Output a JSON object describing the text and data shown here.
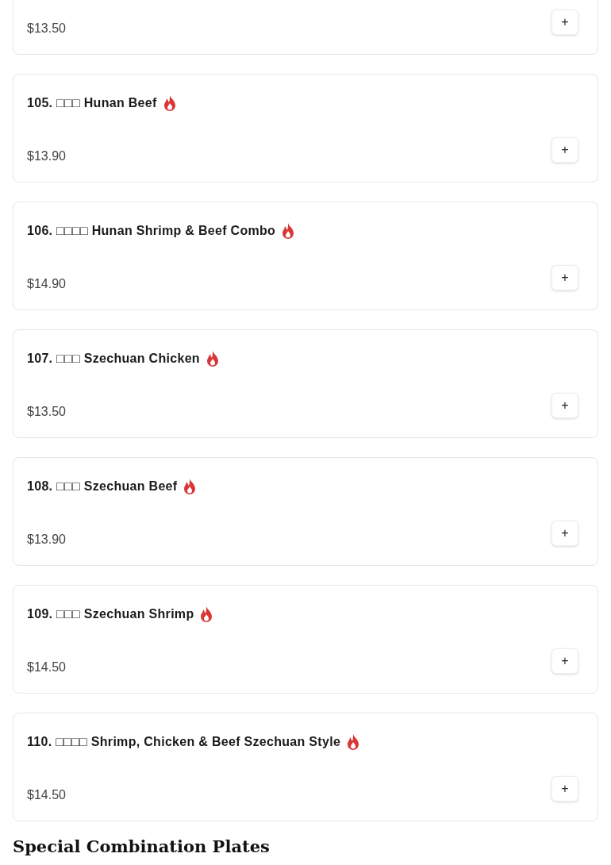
{
  "items": [
    {
      "price": "$13.50",
      "add_label": "+"
    },
    {
      "title": "105. □□□ Hunan Beef",
      "spicy": true,
      "price": "$13.90",
      "add_label": "+"
    },
    {
      "title": "106. □□□□ Hunan Shrimp & Beef Combo",
      "spicy": true,
      "price": "$14.90",
      "add_label": "+"
    },
    {
      "title": "107. □□□ Szechuan Chicken",
      "spicy": true,
      "price": "$13.50",
      "add_label": "+"
    },
    {
      "title": "108. □□□ Szechuan Beef",
      "spicy": true,
      "price": "$13.90",
      "add_label": "+"
    },
    {
      "title": "109. □□□ Szechuan Shrimp",
      "spicy": true,
      "price": "$14.50",
      "add_label": "+"
    },
    {
      "title": "110. □□□□ Shrimp, Chicken & Beef Szechuan Style",
      "spicy": true,
      "price": "$14.50",
      "add_label": "+"
    }
  ],
  "next_section": {
    "heading": "Special Combination Plates"
  }
}
